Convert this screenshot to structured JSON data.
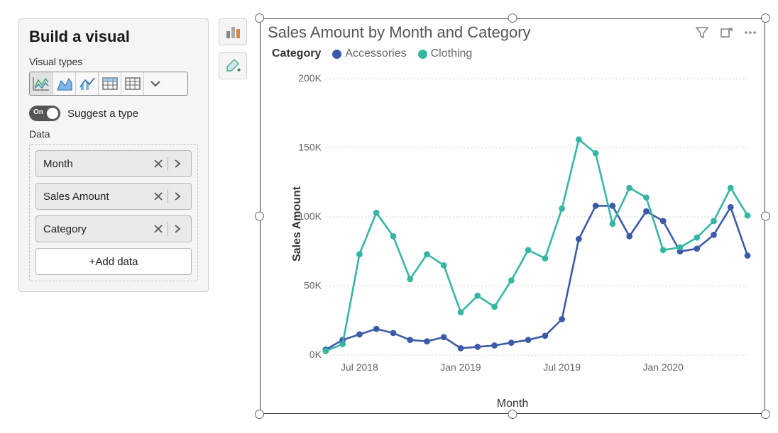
{
  "panel": {
    "title": "Build a visual",
    "visual_types_label": "Visual types",
    "suggest_toggle": {
      "on_label": "On",
      "label": "Suggest a type"
    },
    "data_label": "Data",
    "fields": [
      {
        "name": "Month"
      },
      {
        "name": "Sales Amount"
      },
      {
        "name": "Category"
      }
    ],
    "add_data_label": "+Add data"
  },
  "visual_header": {
    "title": "Sales Amount by Month and Category"
  },
  "legend": {
    "title": "Category",
    "items": [
      {
        "name": "Accessories",
        "color": "#3b5aa8"
      },
      {
        "name": "Clothing",
        "color": "#36b6a2"
      }
    ]
  },
  "axes": {
    "y_label": "Sales Amount",
    "x_label": "Month"
  },
  "chart_data": {
    "type": "line",
    "title": "Sales Amount by Month and Category",
    "xlabel": "Month",
    "ylabel": "Sales Amount",
    "ylim": [
      0,
      200000
    ],
    "y_ticks": [
      0,
      50000,
      100000,
      150000,
      200000
    ],
    "y_tick_labels": [
      "0K",
      "50K",
      "100K",
      "150K",
      "200K"
    ],
    "x": [
      "May 2018",
      "Jun 2018",
      "Jul 2018",
      "Aug 2018",
      "Sep 2018",
      "Oct 2018",
      "Nov 2018",
      "Dec 2018",
      "Jan 2019",
      "Feb 2019",
      "Mar 2019",
      "Apr 2019",
      "May 2019",
      "Jun 2019",
      "Jul 2019",
      "Aug 2019",
      "Sep 2019",
      "Oct 2019",
      "Nov 2019",
      "Dec 2019",
      "Jan 2020",
      "Feb 2020",
      "Mar 2020",
      "Apr 2020",
      "May 2020",
      "Jun 2020"
    ],
    "x_tick_indices": [
      2,
      8,
      14,
      20
    ],
    "x_tick_labels": [
      "Jul 2018",
      "Jan 2019",
      "Jul 2019",
      "Jan 2020"
    ],
    "series": [
      {
        "name": "Accessories",
        "color": "#3b5aa8",
        "values": [
          4000,
          11000,
          15000,
          19000,
          16000,
          11000,
          10000,
          13000,
          5000,
          6000,
          7000,
          9000,
          11000,
          14000,
          26000,
          84000,
          108000,
          108000,
          86000,
          104000,
          97000,
          75000,
          77000,
          87000,
          107000,
          72000
        ]
      },
      {
        "name": "Clothing",
        "color": "#36b6a2",
        "values": [
          3000,
          8000,
          73000,
          103000,
          86000,
          55000,
          73000,
          65000,
          31000,
          43000,
          35000,
          54000,
          76000,
          70000,
          106000,
          156000,
          146000,
          95000,
          121000,
          114000,
          76000,
          78000,
          85000,
          97000,
          121000,
          101000
        ]
      }
    ]
  }
}
